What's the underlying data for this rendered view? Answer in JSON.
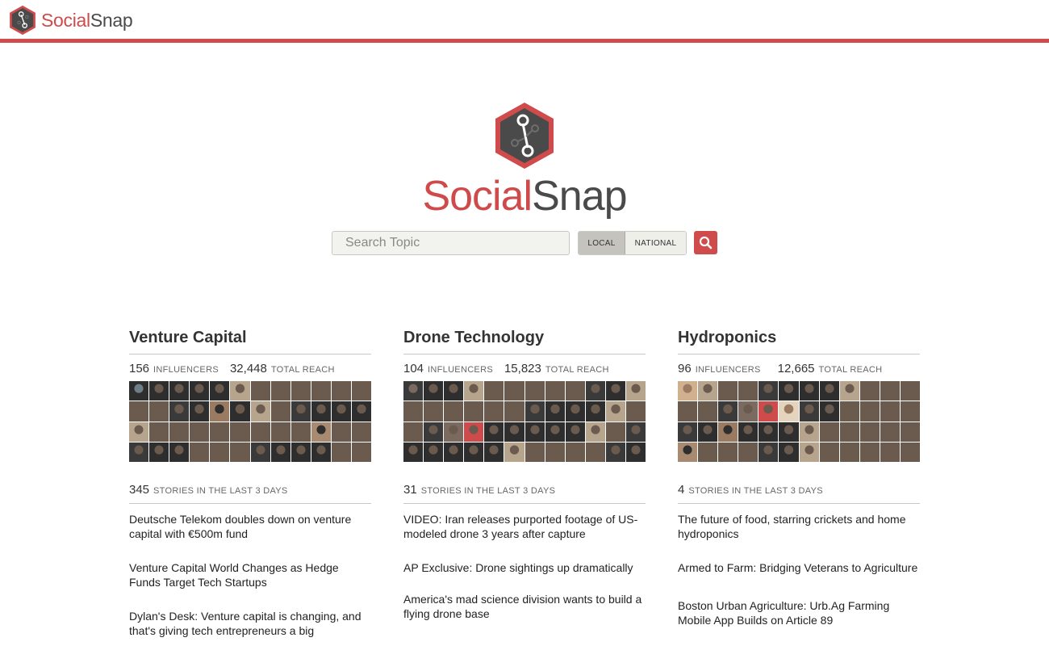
{
  "brand": {
    "name_part1": "Social",
    "name_part2": "Snap",
    "accent_color": "#d04b4b",
    "logo_icon": "hexagon-network-icon"
  },
  "search": {
    "placeholder": "Search Topic",
    "value": "",
    "scope_options": [
      "LOCAL",
      "NATIONAL"
    ],
    "selected_scope": "LOCAL",
    "button_icon": "search-icon"
  },
  "topics": [
    {
      "title": "Venture Capital",
      "influencers": "156",
      "influencers_label": "INFLUENCERS",
      "reach": "32,448",
      "reach_label": "TOTAL REACH",
      "stories_count": "345",
      "stories_label": "STORIES IN THE LAST 3 DAYS",
      "stories": [
        "Deutsche Telekom doubles down on venture capital with €500m fund",
        "Venture Capital World Changes as Hedge Funds Target Tech Startups",
        "Dylan's Desk: Venture capital is changing, and that's giving tech entrepreneurs a big"
      ]
    },
    {
      "title": "Drone Technology",
      "influencers": "104",
      "influencers_label": "INFLUENCERS",
      "reach": "15,823",
      "reach_label": "TOTAL REACH",
      "stories_count": "31",
      "stories_label": "STORIES IN THE LAST 3 DAYS",
      "stories": [
        "VIDEO: Iran releases purported footage of US-modeled drone 3 years after capture",
        "AP Exclusive: Drone sightings up dramatically",
        "America's mad science division wants to build a flying drone base"
      ]
    },
    {
      "title": "Hydroponics",
      "influencers": "96",
      "influencers_label": "INFLUENCERS",
      "reach": "12,665",
      "reach_label": "TOTAL REACH",
      "stories_count": "4",
      "stories_label": "STORIES IN THE LAST 3 DAYS",
      "stories": [
        "The future of food, starring crickets and home hydroponics",
        "Armed to Farm: Bridging Veterans to Agriculture",
        "Boston Urban Agriculture: Urb.Ag Farming Mobile App Builds on Article 89"
      ]
    }
  ]
}
